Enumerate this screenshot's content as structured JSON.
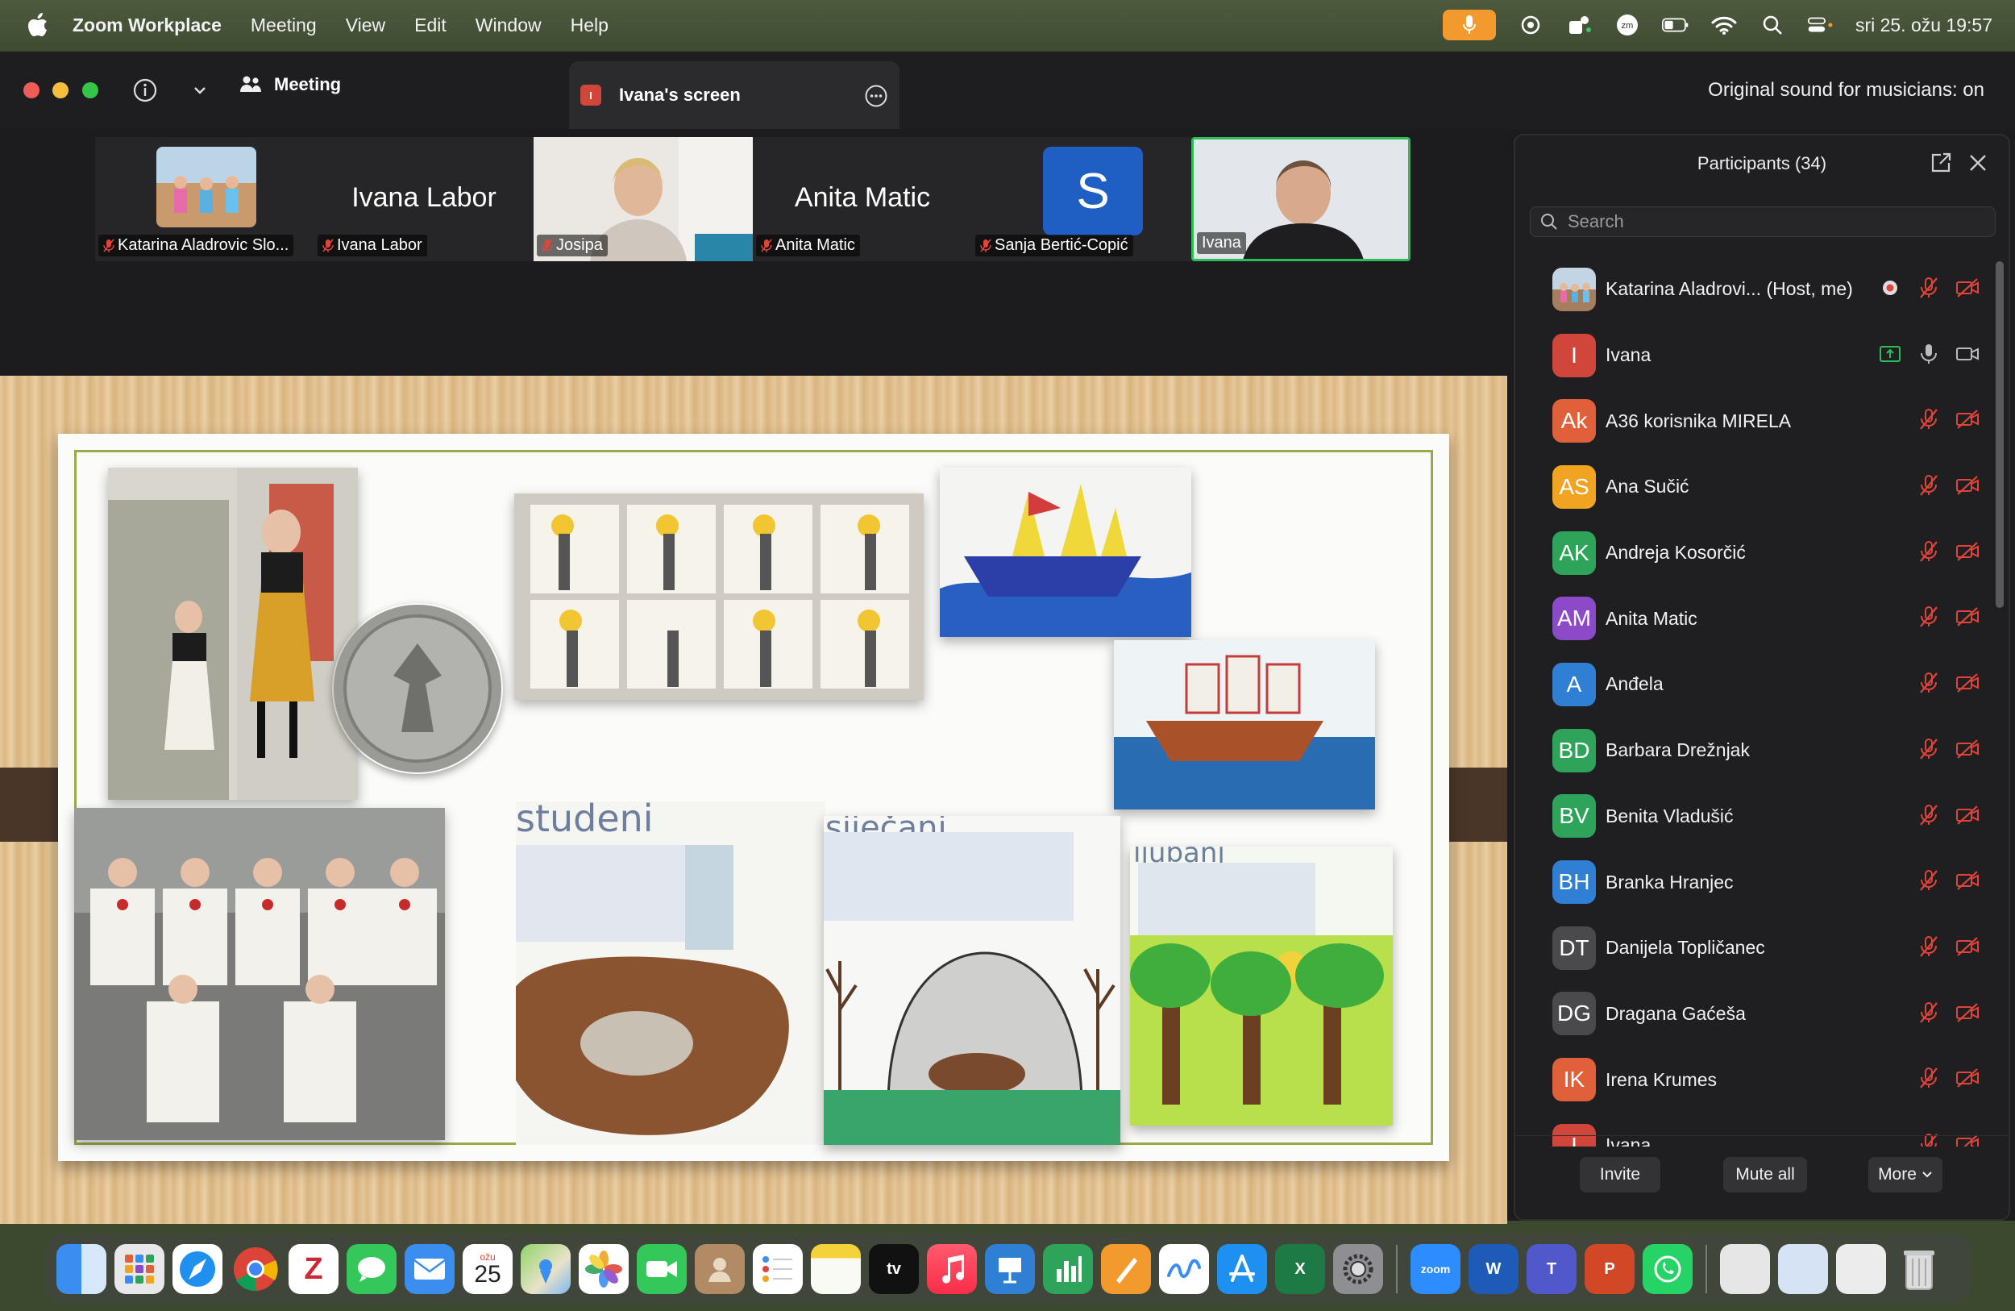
{
  "menubar": {
    "app_name": "Zoom Workplace",
    "menus": [
      "Meeting",
      "View",
      "Edit",
      "Window",
      "Help"
    ],
    "datetime": "sri 25. ožu  19:57"
  },
  "window": {
    "meeting_tab": "Meeting",
    "screen_tab": "Ivana's screen",
    "screen_tab_badge": "I",
    "original_sound": "Original sound for musicians: on"
  },
  "thumbnails": [
    {
      "name": "Katarina Aladrovic Slo...",
      "big": ""
    },
    {
      "name": "Ivana Labor",
      "big": "Ivana Labor"
    },
    {
      "name": "Josipa",
      "big": ""
    },
    {
      "name": "Anita Matic",
      "big": "Anita Matic"
    },
    {
      "name": "Sanja Bertić-Copić",
      "big": "S"
    },
    {
      "name": "Ivana",
      "big": ""
    }
  ],
  "slide": {
    "captions": [
      "studeni",
      "siječanj",
      "ljubanj"
    ]
  },
  "panel": {
    "title": "Participants (34)",
    "search_placeholder": "Search",
    "participants": [
      {
        "initials": "",
        "name": "Katarina Aladrovi...  (Host, me)",
        "color": "#6b7f99"
      },
      {
        "initials": "I",
        "name": "Ivana",
        "color": "#d1463b"
      },
      {
        "initials": "Ak",
        "name": "A36 korisnika MIRELA",
        "color": "#e0603a"
      },
      {
        "initials": "AS",
        "name": "Ana Sučić",
        "color": "#f0a422"
      },
      {
        "initials": "AK",
        "name": "Andreja Kosorčić",
        "color": "#2ea35a"
      },
      {
        "initials": "AM",
        "name": "Anita Matic",
        "color": "#8b4ac8"
      },
      {
        "initials": "A",
        "name": "Anđela",
        "color": "#2f7fd4"
      },
      {
        "initials": "BD",
        "name": "Barbara Drežnjak",
        "color": "#2ea35a"
      },
      {
        "initials": "BV",
        "name": "Benita Vladušić",
        "color": "#2ea35a"
      },
      {
        "initials": "BH",
        "name": "Branka Hranjec",
        "color": "#2f7fd4"
      },
      {
        "initials": "DT",
        "name": "Danijela Topličanec",
        "color": "#4a4a4c"
      },
      {
        "initials": "DG",
        "name": "Dragana Gaćeša",
        "color": "#4a4a4c"
      },
      {
        "initials": "IK",
        "name": "Irena Krumes",
        "color": "#e0603a"
      },
      {
        "initials": "I",
        "name": "Ivana",
        "color": "#d1463b"
      }
    ],
    "invite": "Invite",
    "mute_all": "Mute all",
    "more": "More"
  },
  "dock": {
    "calendar_month": "ožu",
    "calendar_day": "25",
    "zoom_label": "zoom",
    "tv_label": "tv"
  },
  "colors": {
    "accent_orange": "#f29a2e",
    "active_green": "#2ebd59",
    "muted_red": "#e0453a"
  }
}
